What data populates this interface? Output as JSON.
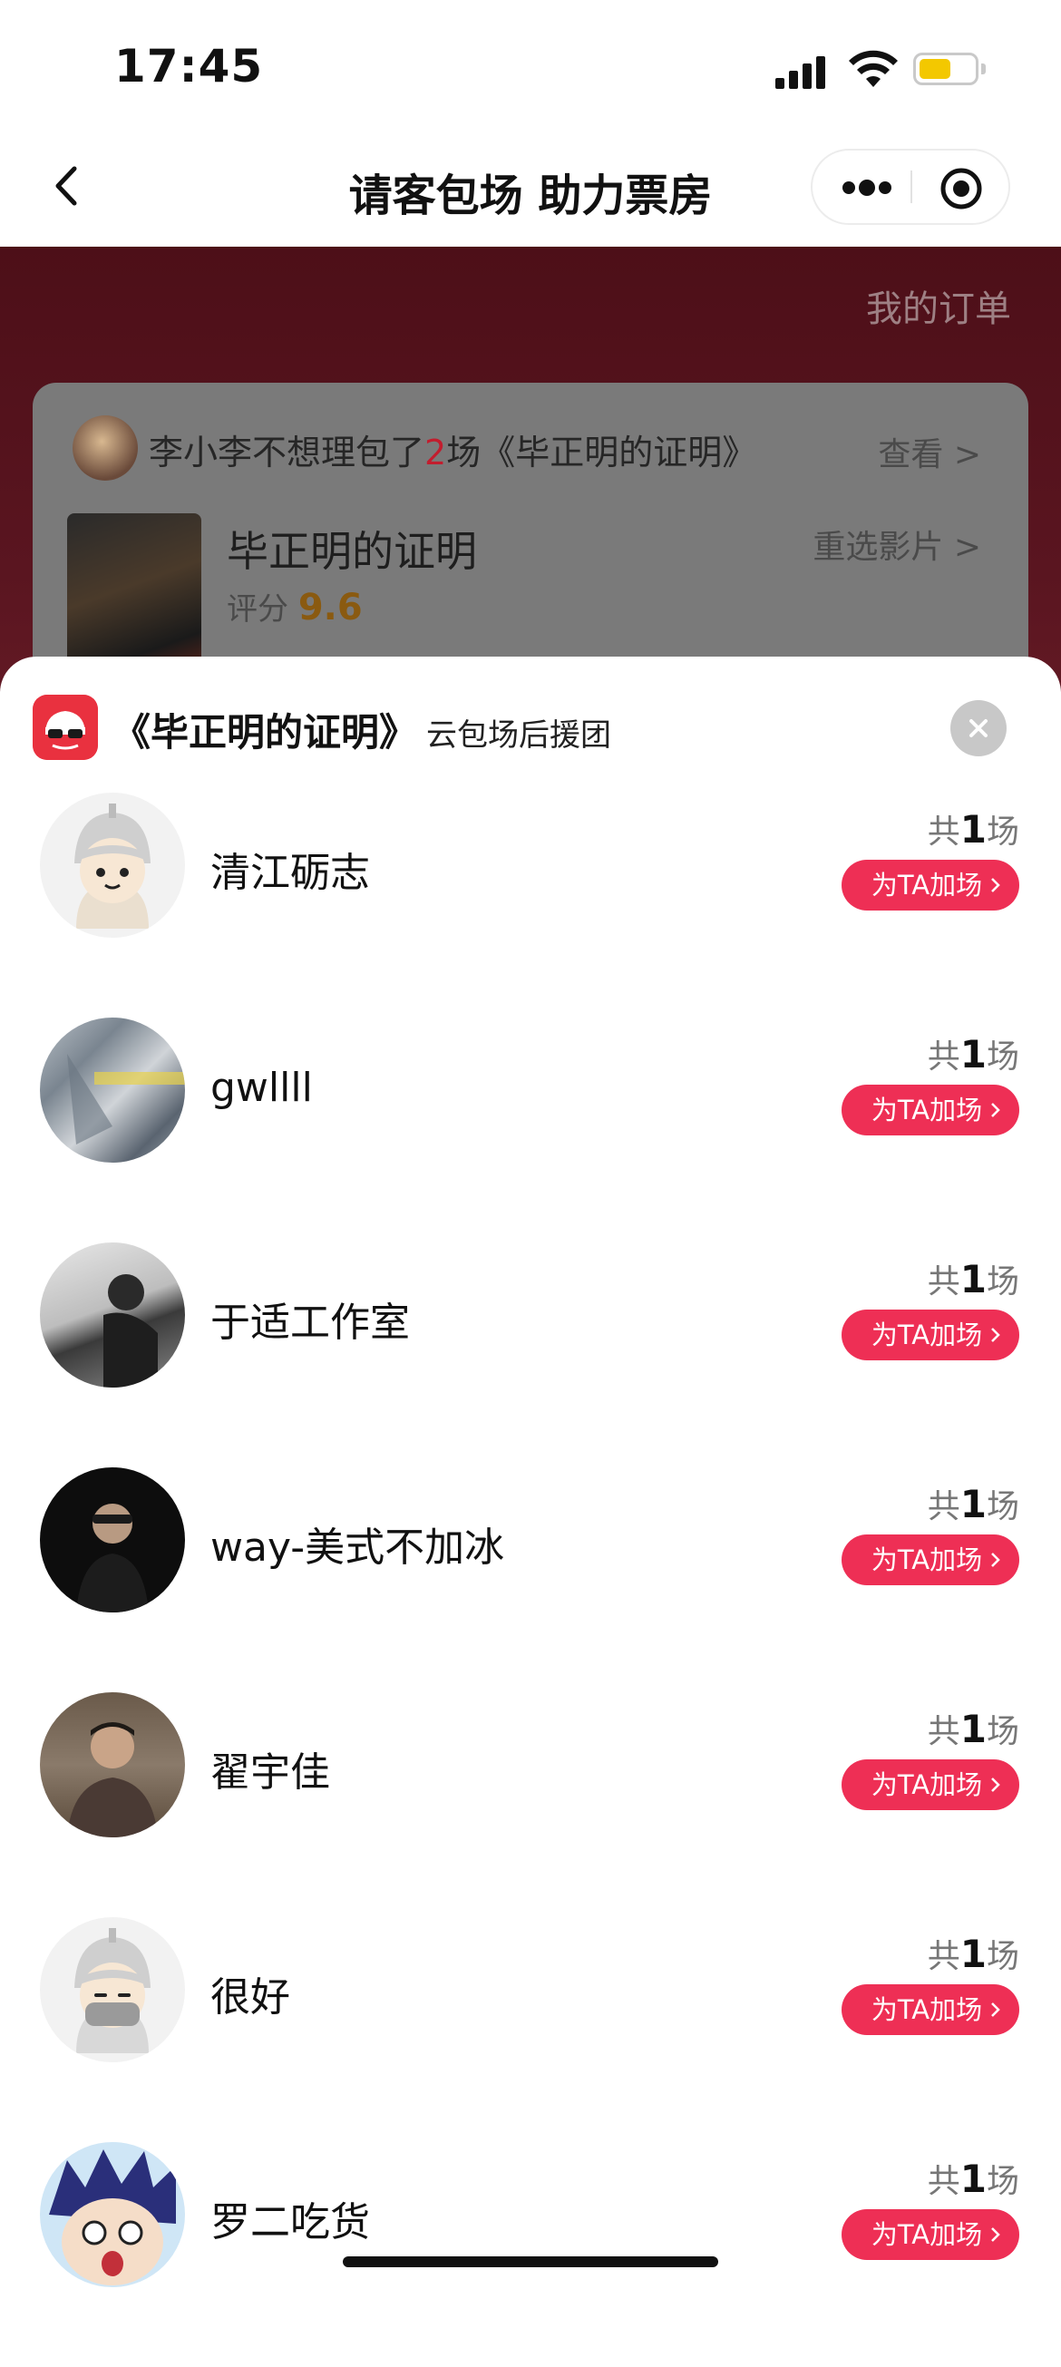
{
  "status_bar": {
    "time": "17:45"
  },
  "nav": {
    "title": "请客包场 助力票房"
  },
  "background": {
    "my_orders": "我的订单",
    "summary_prefix": "李小李不想理包了",
    "summary_count": "2",
    "summary_suffix": "场《毕正明的证明》",
    "view_label": "查看 >",
    "movie_title": "毕正明的证明",
    "rechoose_label": "重选影片 >",
    "score_label": "评分",
    "score_value": "9.6"
  },
  "sheet": {
    "title": "《毕正明的证明》",
    "subtitle": "云包场后援团",
    "users": [
      {
        "name": "清江砺志",
        "count_prefix": "共",
        "count": "1",
        "count_suffix": "场",
        "button": "为TA加场",
        "avatar": "default-avatar"
      },
      {
        "name": "gwllll",
        "count_prefix": "共",
        "count": "1",
        "count_suffix": "场",
        "button": "为TA加场",
        "avatar": "photo-avatar"
      },
      {
        "name": "于适工作室",
        "count_prefix": "共",
        "count": "1",
        "count_suffix": "场",
        "button": "为TA加场",
        "avatar": "photo-avatar"
      },
      {
        "name": "way-美式不加冰",
        "count_prefix": "共",
        "count": "1",
        "count_suffix": "场",
        "button": "为TA加场",
        "avatar": "photo-avatar"
      },
      {
        "name": "翟宇佳",
        "count_prefix": "共",
        "count": "1",
        "count_suffix": "场",
        "button": "为TA加场",
        "avatar": "photo-avatar"
      },
      {
        "name": "很好",
        "count_prefix": "共",
        "count": "1",
        "count_suffix": "场",
        "button": "为TA加场",
        "avatar": "default-avatar"
      },
      {
        "name": "罗二吃货",
        "count_prefix": "共",
        "count": "1",
        "count_suffix": "场",
        "button": "为TA加场",
        "avatar": "cartoon-avatar"
      }
    ]
  },
  "colors": {
    "accent": "#ee2f55",
    "logo": "#e9313f",
    "backdrop": "#5a1520"
  }
}
